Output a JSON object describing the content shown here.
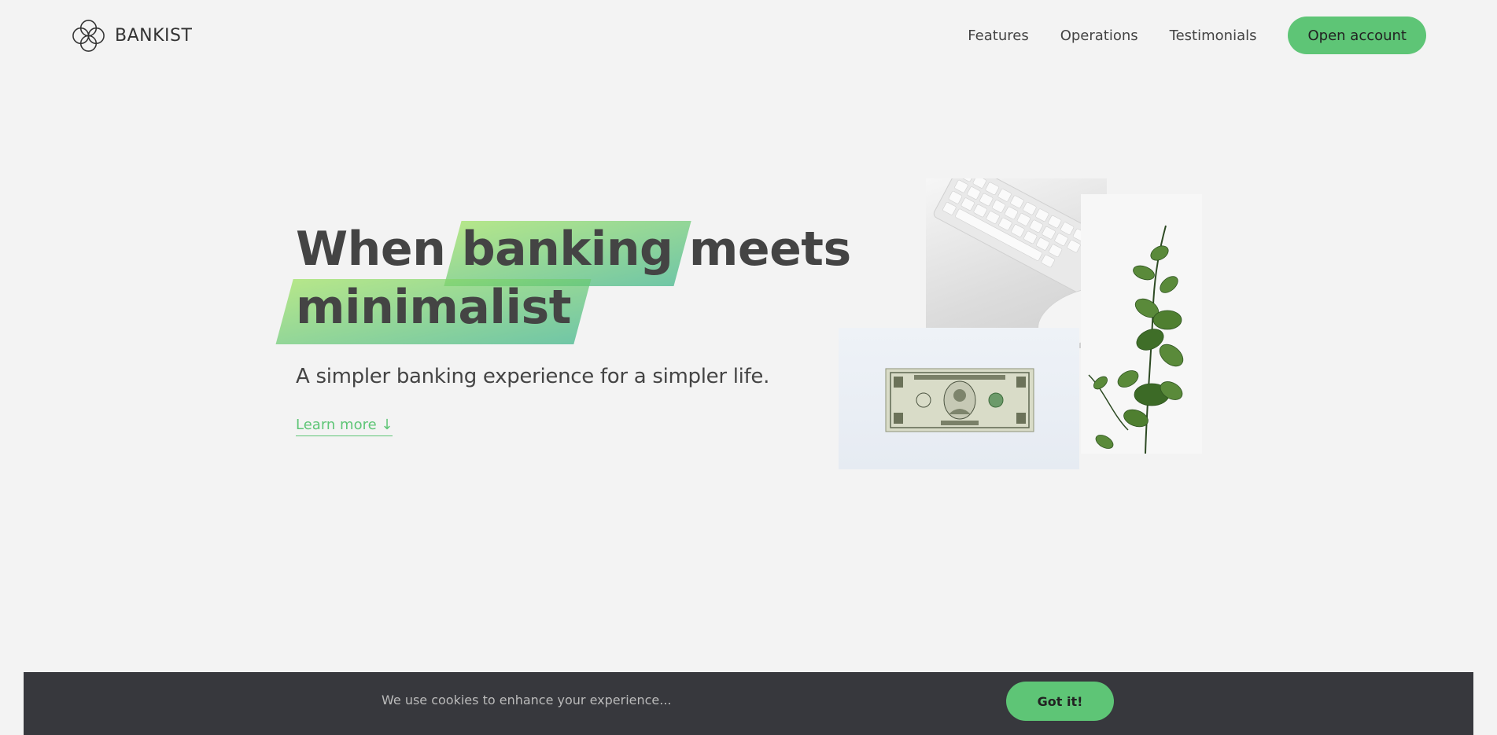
{
  "brand": {
    "name": "BANKIST",
    "icon": "four-rings-logo-icon"
  },
  "nav": {
    "links": [
      "Features",
      "Operations",
      "Testimonials"
    ],
    "cta": "Open account"
  },
  "hero": {
    "title_part1": "When",
    "title_highlight1": "banking",
    "title_part2": "meets",
    "title_highlight2": "minimalist",
    "subtitle": "A simpler banking experience for a simpler life.",
    "learn_more": "Learn more ↓"
  },
  "hero_images": {
    "image1": "keyboard-and-mouse-photo",
    "image2": "eucalyptus-plant-photo",
    "image3": "one-dollar-bill-photo"
  },
  "cookie": {
    "message": "We use cookies to enhance your experience...",
    "button": "Got it!"
  },
  "colors": {
    "background": "#f3f3f3",
    "primary": "#5ec576",
    "text": "#444444",
    "cookie_bar": "#37383d",
    "highlight_start": "#9be15d",
    "highlight_end": "#39b385"
  }
}
